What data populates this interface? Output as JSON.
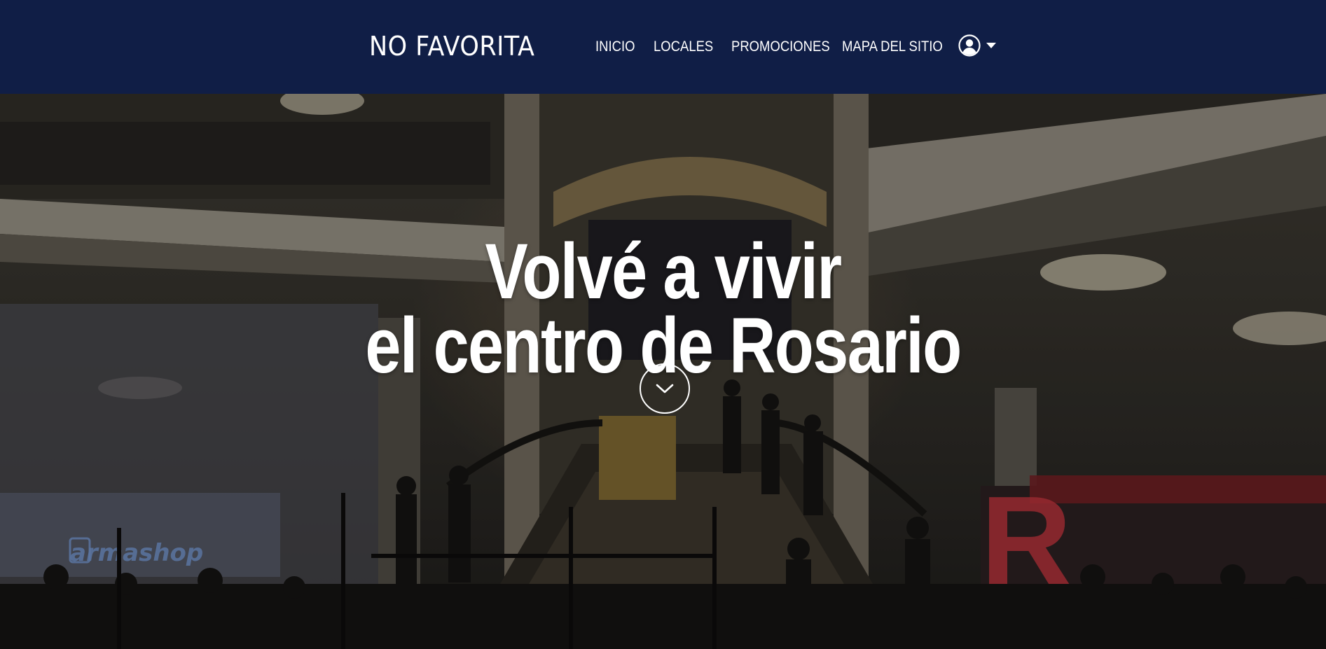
{
  "header": {
    "logo_text": "NO FAVORITA",
    "nav": [
      {
        "label": "INICIO"
      },
      {
        "label": "LOCALES"
      },
      {
        "label": "PROMOCIONES"
      },
      {
        "label": "MAPA DEL SITIO"
      }
    ],
    "user_menu": {
      "icon": "user-circle-icon",
      "dropdown_icon": "caret-down-icon"
    }
  },
  "hero": {
    "title_line1": "Volvé a vivir",
    "title_line2": "el centro de Rosario",
    "scroll_icon": "chevron-down-icon",
    "background_sign": "armashop"
  },
  "colors": {
    "navbar_bg": "#101e46",
    "text": "#ffffff",
    "sign_blue": "#6f8fc4",
    "sign_red": "#b8323a"
  }
}
